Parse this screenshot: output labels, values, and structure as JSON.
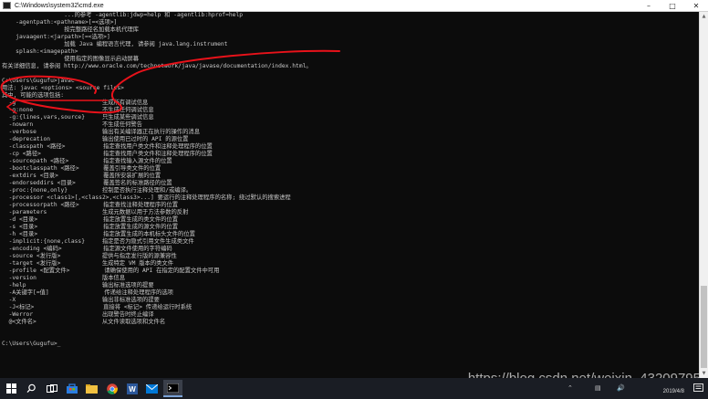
{
  "window": {
    "title": "C:\\Windows\\system32\\cmd.exe",
    "minimize_icon": "minimize-icon",
    "maximize_icon": "maximize-icon",
    "close_icon": "close-icon"
  },
  "console_lines": [
    "                  ...的参考 -agentlib:jdwp=help 和 -agentlib:hprof=help",
    "    -agentpath:<pathname>[=<选项>]",
    "                  按完整路径名加载本机代理库",
    "    javaagent:<jarpath>[=<选项>]",
    "                  加载 Java 编程语言代理, 请参阅 java.lang.instrument",
    "    splash:<imagepath>",
    "                  使用指定的图像显示启动屏幕",
    "有关详细信息, 请参阅 http://www.oracle.com/technetwork/java/javase/documentation/index.html。",
    "",
    "C:\\Users\\Gugufu>javac",
    "用法: javac <options> <source files>",
    "其中, 可能的选项包括:",
    "  -g                         生成所有调试信息",
    "  -g:none                    不生成任何调试信息",
    "  -g:{lines,vars,source}     只生成某些调试信息",
    "  -nowarn                    不生成任何警告",
    "  -verbose                   输出有关编译器正在执行的操作的消息",
    "  -deprecation               输出使用已过时的 API 的源位置",
    "  -classpath <路径>           指定查找用户类文件和注释处理程序的位置",
    "  -cp <路径>                  指定查找用户类文件和注释处理程序的位置",
    "  -sourcepath <路径>          指定查找输入源文件的位置",
    "  -bootclasspath <路径>       覆盖引导类文件的位置",
    "  -extdirs <目录>             覆盖所安装扩展的位置",
    "  -endorseddirs <目录>        覆盖签名的标准路径的位置",
    "  -proc:{none,only}          控制是否执行注释处理和/或编译。",
    "  -processor <class1>[,<class2>,<class3>...] 要运行的注释处理程序的名称; 绕过默认的搜索进程",
    "  -processorpath <路径>       指定查找注释处理程序的位置",
    "  -parameters                生成元数据以用于方法参数的反射",
    "  -d <目录>                   指定放置生成的类文件的位置",
    "  -s <目录>                   指定放置生成的源文件的位置",
    "  -h <目录>                   指定放置生成的本机标头文件的位置",
    "  -implicit:{none,class}     指定是否为隐式引用文件生成类文件",
    "  -encoding <编码>            指定源文件使用的字符编码",
    "  -source <发行版>            提供与指定发行版的源兼容性",
    "  -target <发行版>            生成特定 VM 版本的类文件",
    "  -profile <配置文件>          请确保使用的 API 在指定的配置文件中可用",
    "  -version                   版本信息",
    "  -help                      输出标准选项的提要",
    "  -A关键字[=值]                传递给注释处理程序的选项",
    "  -X                         输出非标准选项的提要",
    "  -J<标记>                    直接将 <标记> 传递给运行时系统",
    "  -Werror                    出现警告时终止编译",
    "  @<文件名>                   从文件读取选项和文件名",
    "",
    "",
    "C:\\Users\\Gugufu>_"
  ],
  "watermark": "https://blog.csdn.net/weixin_43209795",
  "taskbar": {
    "icons": [
      "windows-start-icon",
      "search-icon",
      "task-view-icon",
      "store-icon",
      "file-explorer-icon",
      "chrome-icon",
      "word-icon",
      "mail-icon",
      "cmd-icon"
    ],
    "clock_date": "2019/4/8"
  },
  "colors": {
    "console_bg": "#0c0c0c",
    "console_text": "#c8c8c8",
    "annotation": "#e8121a"
  }
}
